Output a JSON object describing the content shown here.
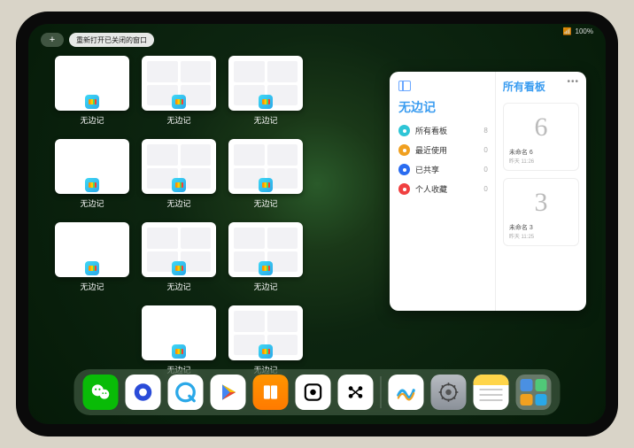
{
  "status": {
    "network": "📶",
    "battery": "100%"
  },
  "topbar": {
    "plus_label": "+",
    "reopen_label": "重新打开已关闭的窗口"
  },
  "app_name": "无边记",
  "grid": {
    "labels": [
      "无边记",
      "无边记",
      "无边记",
      "无边记",
      "无边记",
      "无边记",
      "无边记",
      "无边记",
      "无边记",
      "无边记",
      "无边记"
    ],
    "detailed_indices": [
      1,
      2,
      4,
      5,
      7,
      8,
      10
    ]
  },
  "side_window": {
    "left_title": "无边记",
    "right_title": "所有看板",
    "items": [
      {
        "icon_color": "#2ec5d6",
        "label": "所有看板",
        "count": "8"
      },
      {
        "icon_color": "#f0a020",
        "label": "最近使用",
        "count": "0"
      },
      {
        "icon_color": "#2a6cf0",
        "label": "已共享",
        "count": "0"
      },
      {
        "icon_color": "#f04040",
        "label": "个人收藏",
        "count": "0"
      }
    ],
    "boards": [
      {
        "sketch": "6",
        "title": "未命名 6",
        "date": "昨天 11:26"
      },
      {
        "sketch": "3",
        "title": "未命名 3",
        "date": "昨天 11:25"
      }
    ]
  },
  "dock": {
    "icons": [
      {
        "name": "wechat",
        "bg": "#09bb07"
      },
      {
        "name": "qqbrowser",
        "bg": "#ffffff"
      },
      {
        "name": "quark",
        "bg": "#ffffff"
      },
      {
        "name": "store",
        "bg": "#ffffff"
      },
      {
        "name": "books",
        "bg": "#ff9500"
      },
      {
        "name": "dice",
        "bg": "#ffffff"
      },
      {
        "name": "dots",
        "bg": "#ffffff"
      },
      {
        "name": "freeform",
        "bg": "#ffffff"
      },
      {
        "name": "settings",
        "bg": "#9aa0a6"
      },
      {
        "name": "notes",
        "bg": "#ffffff"
      }
    ]
  }
}
